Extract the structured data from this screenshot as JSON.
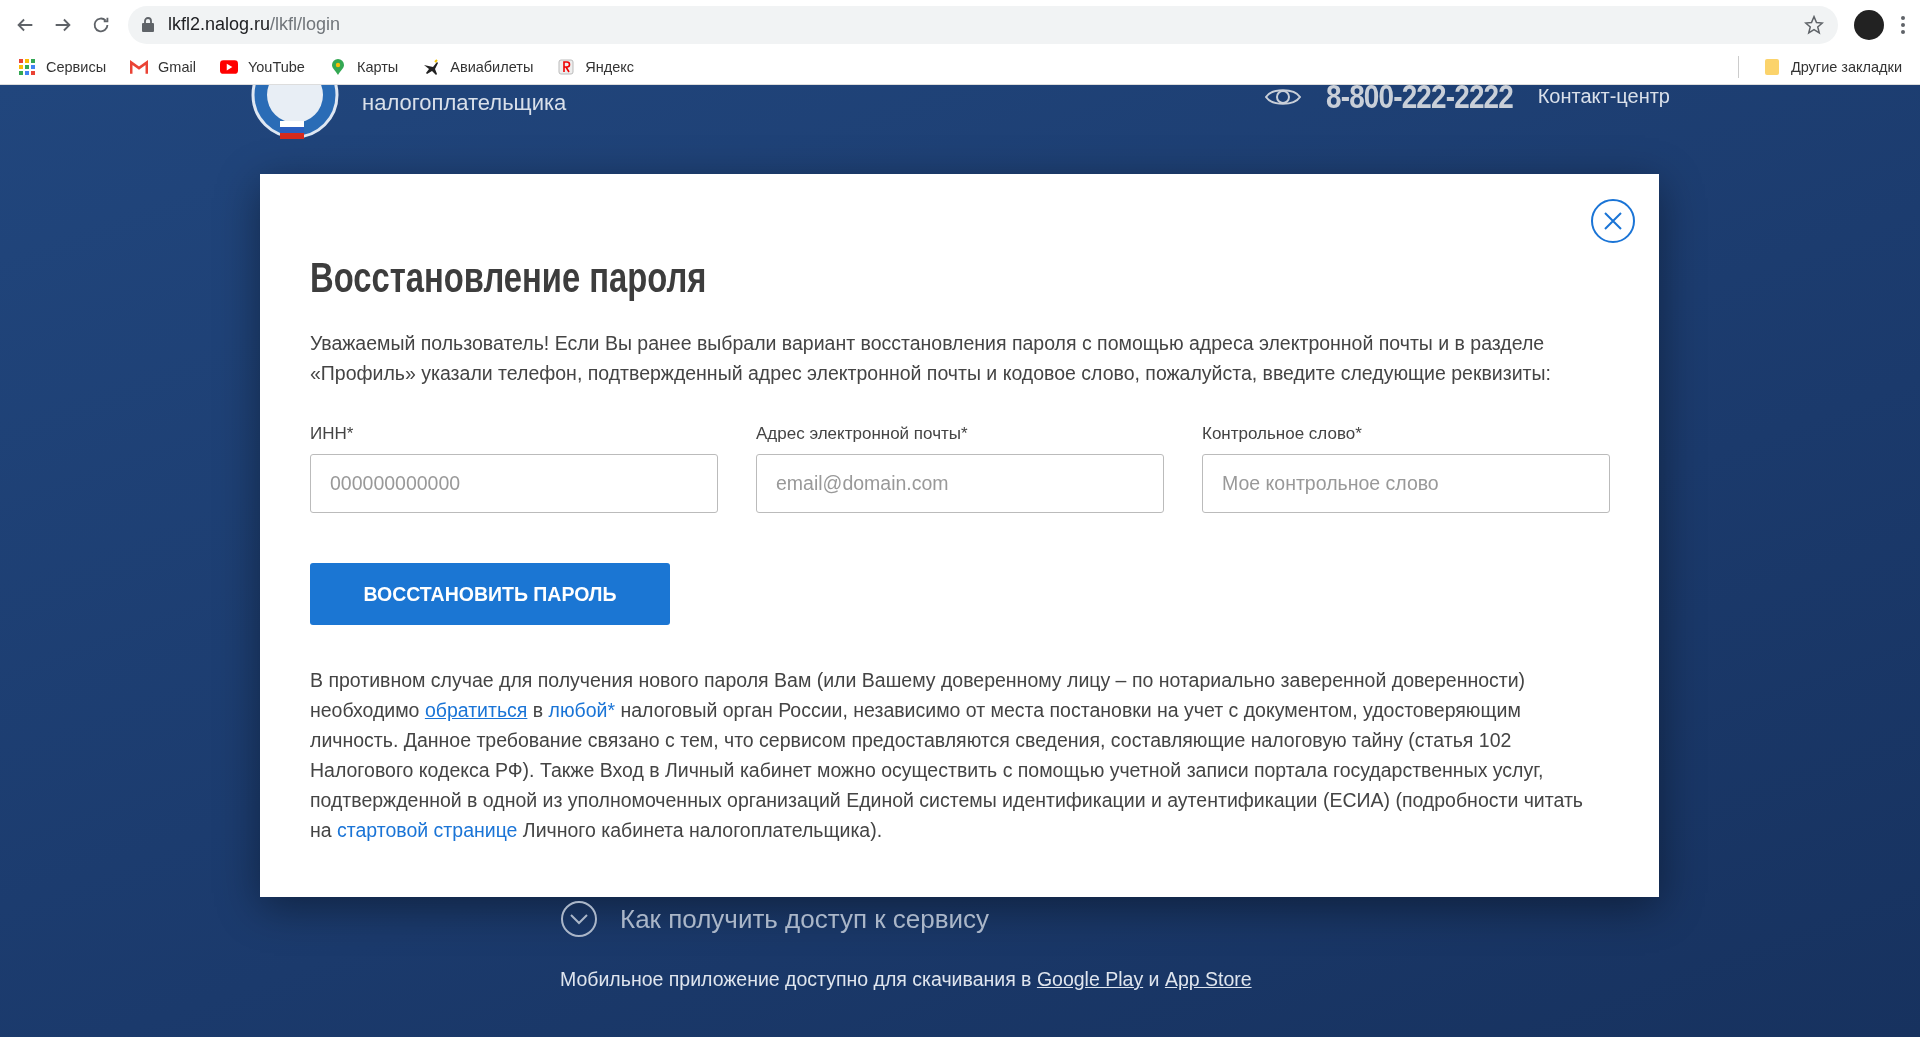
{
  "browser": {
    "url_host": "lkfl2.nalog.ru",
    "url_path": "/lkfl/login",
    "bookmarks": [
      {
        "label": "Сервисы",
        "kind": "apps"
      },
      {
        "label": "Gmail",
        "kind": "mail"
      },
      {
        "label": "YouTube",
        "kind": "video"
      },
      {
        "label": "Карты",
        "kind": "pin"
      },
      {
        "label": "Авиабилеты",
        "kind": "plane"
      },
      {
        "label": "Яндекс",
        "kind": "letter"
      }
    ],
    "other_bookmarks": "Другие закладки"
  },
  "header": {
    "subtitle": "налогоплательщика",
    "phone": "8-800-222-2222",
    "contact": "Контакт-центр"
  },
  "modal": {
    "title": "Восстановление пароля",
    "intro": "Уважаемый пользователь! Если Вы ранее выбрали вариант восстановления пароля с помощью адреса электронной почты и в разделе «Профиль» указали телефон, подтвержденный адрес электронной почты и кодовое слово, пожалуйста, введите следующие реквизиты:",
    "fields": [
      {
        "label": "ИНН*",
        "placeholder": "000000000000"
      },
      {
        "label": "Адрес электронной почты*",
        "placeholder": "email@domain.com"
      },
      {
        "label": "Контрольное слово*",
        "placeholder": "Мое контрольное слово"
      }
    ],
    "button": "ВОССТАНОВИТЬ ПАРОЛЬ",
    "note": [
      {
        "kind": "text",
        "text": "В противном случае для получения нового пароля Вам (или Вашему доверенному лицу – по нотариально заверенной доверенности) необходимо "
      },
      {
        "kind": "underlined-link",
        "text": "обратиться"
      },
      {
        "kind": "text",
        "text": " в "
      },
      {
        "kind": "link",
        "text": "любой*"
      },
      {
        "kind": "text",
        "text": " налоговый орган России, независимо от места постановки на учет с документом, удостоверяющим личность. Данное требование связано с тем, что сервисом предоставляются сведения, составляющие налоговую тайну (статья 102 Налогового кодекса РФ). Также Вход в Личный кабинет можно осуществить с помощью учетной записи портала государственных услуг, подтвержденной в одной из уполномоченных организаций Единой системы идентификации и аутентификации (ЕСИА) (подробности читать на "
      },
      {
        "kind": "link",
        "text": "стартовой странице"
      },
      {
        "kind": "text",
        "text": " Личного кабинета налогоплательщика)."
      }
    ]
  },
  "footer": {
    "access": "Как получить доступ к сервису",
    "mobile": [
      {
        "kind": "text",
        "text": "Мобильное приложение доступно для скачивания в "
      },
      {
        "kind": "underlined-link",
        "text": "Google Play"
      },
      {
        "kind": "text",
        "text": " и "
      },
      {
        "kind": "underlined-link",
        "text": "App Store"
      }
    ]
  }
}
